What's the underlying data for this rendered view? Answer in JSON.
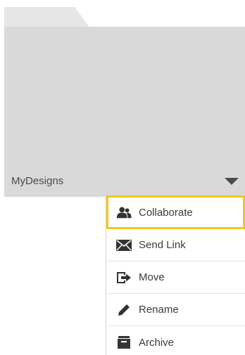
{
  "folder": {
    "name": "MyDesigns",
    "toggle_icon": "caret-down-icon"
  },
  "menu": {
    "items": [
      {
        "label": "Collaborate",
        "icon": "collaborate-icon",
        "active": true
      },
      {
        "label": "Send Link",
        "icon": "envelope-icon",
        "active": false
      },
      {
        "label": "Move",
        "icon": "move-icon",
        "active": false
      },
      {
        "label": "Rename",
        "icon": "pencil-icon",
        "active": false
      },
      {
        "label": "Archive",
        "icon": "archive-icon",
        "active": false
      }
    ],
    "highlight_color": "#f2c71b"
  },
  "colors": {
    "folder_fill": "#d9d9d9",
    "folder_tab": "#e6e6e6",
    "text": "#3b3b3b",
    "icon": "#333333"
  }
}
